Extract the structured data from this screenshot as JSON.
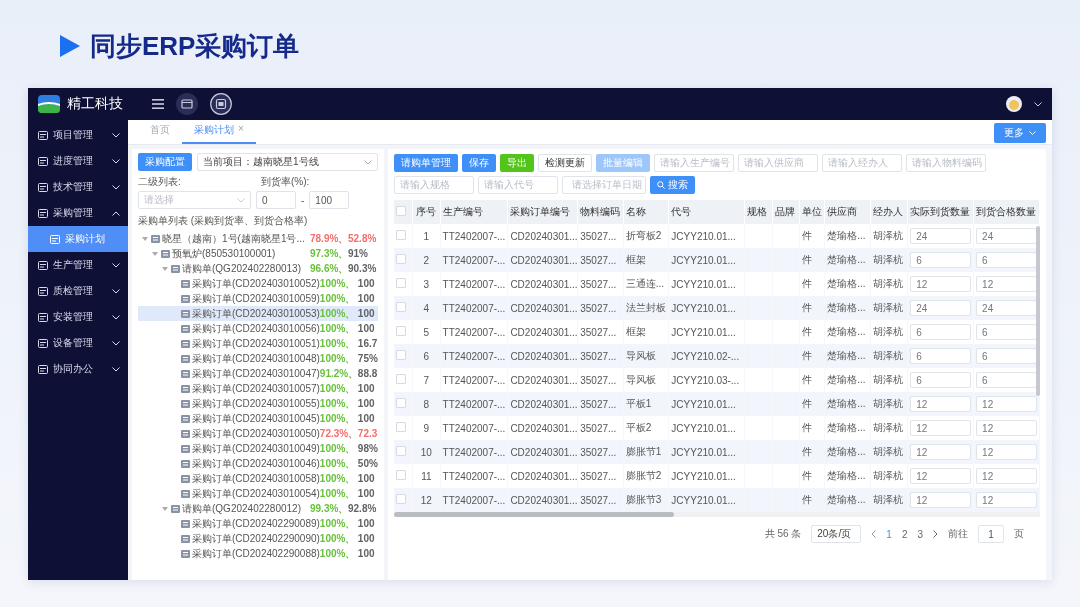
{
  "slide_title": "同步ERP采购订单",
  "header": {
    "brand": "精工科技"
  },
  "sidebar": {
    "items": [
      {
        "label": "项目管理",
        "selected": false,
        "expanded": false
      },
      {
        "label": "进度管理",
        "selected": false,
        "expanded": false
      },
      {
        "label": "技术管理",
        "selected": false,
        "expanded": false
      },
      {
        "label": "采购管理",
        "selected": false,
        "expanded": true,
        "children": [
          {
            "label": "采购计划",
            "selected": true
          }
        ]
      },
      {
        "label": "生产管理",
        "selected": false,
        "expanded": false
      },
      {
        "label": "质检管理",
        "selected": false,
        "expanded": false
      },
      {
        "label": "安装管理",
        "selected": false,
        "expanded": false
      },
      {
        "label": "设备管理",
        "selected": false,
        "expanded": false
      },
      {
        "label": "协同办公",
        "selected": false,
        "expanded": false
      }
    ]
  },
  "tabs": [
    {
      "label": "首页",
      "selected": false
    },
    {
      "label": "采购计划",
      "selected": true,
      "close": "×"
    }
  ],
  "more_button": "更多",
  "left_panel": {
    "config_button": "采购配置",
    "project": "当前项目：越南晓星1号线",
    "level2_label": "二级列表:",
    "level2_placeholder": "请选择",
    "rate_label": "到货率(%):",
    "rate_min": "0",
    "rate_sep": "-",
    "rate_max": "100",
    "list_title": "采购单列表 (采购到货率、到货合格率)",
    "tree": [
      {
        "label": "晓星（越南）1号(越南晓星1号...",
        "arrival": {
          "text": "78.9%、",
          "color": "#f56c6c"
        },
        "pass": {
          "text": "52.8%",
          "color": "#f56c6c"
        },
        "selected": false,
        "expanded": true,
        "children": [
          {
            "label": "预氧炉(850530100001)",
            "arrival": {
              "text": "97.3%、",
              "color": "#67c23a"
            },
            "pass": {
              "text": "91%",
              "color": "#606266"
            },
            "selected": false,
            "expanded": true,
            "children": [
              {
                "label": "请购单(QG202402280013)",
                "arrival": {
                  "text": "96.6%、",
                  "color": "#67c23a"
                },
                "pass": {
                  "text": "90.3%",
                  "color": "#606266"
                },
                "selected": false,
                "expanded": true,
                "children": [
                  {
                    "label": "采购订单(CD202403010052)",
                    "arrival": {
                      "text": "100%、",
                      "color": "#67c23a"
                    },
                    "pass": {
                      "text": "100",
                      "color": "#606266"
                    },
                    "selected": false
                  },
                  {
                    "label": "采购订单(CD202403010059)",
                    "arrival": {
                      "text": "100%、",
                      "color": "#67c23a"
                    },
                    "pass": {
                      "text": "100",
                      "color": "#606266"
                    },
                    "selected": false
                  },
                  {
                    "label": "采购订单(CD202403010053)",
                    "arrival": {
                      "text": "100%、",
                      "color": "#67c23a"
                    },
                    "pass": {
                      "text": "100",
                      "color": "#606266"
                    },
                    "selected": true
                  },
                  {
                    "label": "采购订单(CD202403010056)",
                    "arrival": {
                      "text": "100%、",
                      "color": "#67c23a"
                    },
                    "pass": {
                      "text": "100",
                      "color": "#606266"
                    },
                    "selected": false
                  },
                  {
                    "label": "采购订单(CD202403010051)",
                    "arrival": {
                      "text": "100%、",
                      "color": "#67c23a"
                    },
                    "pass": {
                      "text": "16.7",
                      "color": "#606266"
                    },
                    "selected": false
                  },
                  {
                    "label": "采购订单(CD202403010048)",
                    "arrival": {
                      "text": "100%、",
                      "color": "#67c23a"
                    },
                    "pass": {
                      "text": "75%",
                      "color": "#606266"
                    },
                    "selected": false
                  },
                  {
                    "label": "采购订单(CD202403010047)",
                    "arrival": {
                      "text": "91.2%、",
                      "color": "#67c23a"
                    },
                    "pass": {
                      "text": "88.8",
                      "color": "#606266"
                    },
                    "selected": false
                  },
                  {
                    "label": "采购订单(CD202403010057)",
                    "arrival": {
                      "text": "100%、",
                      "color": "#67c23a"
                    },
                    "pass": {
                      "text": "100",
                      "color": "#606266"
                    },
                    "selected": false
                  },
                  {
                    "label": "采购订单(CD202403010055)",
                    "arrival": {
                      "text": "100%、",
                      "color": "#67c23a"
                    },
                    "pass": {
                      "text": "100",
                      "color": "#606266"
                    },
                    "selected": false
                  },
                  {
                    "label": "采购订单(CD202403010045)",
                    "arrival": {
                      "text": "100%、",
                      "color": "#67c23a"
                    },
                    "pass": {
                      "text": "100",
                      "color": "#606266"
                    },
                    "selected": false
                  },
                  {
                    "label": "采购订单(CD202403010050)",
                    "arrival": {
                      "text": "72.3%、",
                      "color": "#f56c6c"
                    },
                    "pass": {
                      "text": "72.3",
                      "color": "#f56c6c"
                    },
                    "selected": false
                  },
                  {
                    "label": "采购订单(CD202403010049)",
                    "arrival": {
                      "text": "100%、",
                      "color": "#67c23a"
                    },
                    "pass": {
                      "text": "98%",
                      "color": "#606266"
                    },
                    "selected": false
                  },
                  {
                    "label": "采购订单(CD202403010046)",
                    "arrival": {
                      "text": "100%、",
                      "color": "#67c23a"
                    },
                    "pass": {
                      "text": "50%",
                      "color": "#606266"
                    },
                    "selected": false
                  },
                  {
                    "label": "采购订单(CD202403010058)",
                    "arrival": {
                      "text": "100%、",
                      "color": "#67c23a"
                    },
                    "pass": {
                      "text": "100",
                      "color": "#606266"
                    },
                    "selected": false
                  },
                  {
                    "label": "采购订单(CD202403010054)",
                    "arrival": {
                      "text": "100%、",
                      "color": "#67c23a"
                    },
                    "pass": {
                      "text": "100",
                      "color": "#606266"
                    },
                    "selected": false
                  }
                ]
              },
              {
                "label": "请购单(QG202402280012)",
                "arrival": {
                  "text": "99.3%、",
                  "color": "#67c23a"
                },
                "pass": {
                  "text": "92.8%",
                  "color": "#606266"
                },
                "selected": false,
                "expanded": true,
                "children": [
                  {
                    "label": "采购订单(CD202402290089)",
                    "arrival": {
                      "text": "100%、",
                      "color": "#67c23a"
                    },
                    "pass": {
                      "text": "100",
                      "color": "#606266"
                    },
                    "selected": false
                  },
                  {
                    "label": "采购订单(CD202402290090)",
                    "arrival": {
                      "text": "100%、",
                      "color": "#67c23a"
                    },
                    "pass": {
                      "text": "100",
                      "color": "#606266"
                    },
                    "selected": false
                  },
                  {
                    "label": "采购订单(CD202402290088)",
                    "arrival": {
                      "text": "100%、",
                      "color": "#67c23a"
                    },
                    "pass": {
                      "text": "100",
                      "color": "#606266"
                    },
                    "selected": false
                  }
                ]
              }
            ]
          }
        ]
      }
    ]
  },
  "toolbar": {
    "buttons": [
      {
        "label": "请购单管理",
        "kind": "primary",
        "disabled": false
      },
      {
        "label": "保存",
        "kind": "primary",
        "disabled": false
      },
      {
        "label": "导出",
        "kind": "success",
        "disabled": false
      },
      {
        "label": "检测更新",
        "kind": "plain",
        "disabled": false
      },
      {
        "label": "批量编辑",
        "kind": "primary",
        "disabled": true
      }
    ],
    "filters": [
      {
        "placeholder": "请输入生产编号",
        "kind": "text"
      },
      {
        "placeholder": "请输入供应商",
        "kind": "text"
      },
      {
        "placeholder": "请输入经办人",
        "kind": "text"
      },
      {
        "placeholder": "请输入物料编码",
        "kind": "text"
      },
      {
        "placeholder": "请输入规格",
        "kind": "text"
      },
      {
        "placeholder": "请输入代号",
        "kind": "text"
      },
      {
        "placeholder": "请选择订单日期",
        "kind": "date"
      }
    ],
    "search_button": "搜索"
  },
  "table": {
    "header_checked": false,
    "columns": [
      "序号",
      "生产编号",
      "采购订单编号",
      "物料编码",
      "名称",
      "代号",
      "规格",
      "品牌",
      "单位",
      "供应商",
      "经办人",
      "实际到货数量",
      "到货合格数量"
    ],
    "rows": [
      {
        "checked": false,
        "no": "1",
        "prod_no": "TT2402007-...",
        "order_no": "CD20240301...",
        "material": "35027...",
        "name": "折弯板2",
        "code": "JCYY210.01...",
        "unit": "件",
        "supplier": "楚瑜格...",
        "handler": "胡泽杭",
        "actual_qty": "24",
        "qualified_qty": "24"
      },
      {
        "checked": false,
        "no": "2",
        "prod_no": "TT2402007-...",
        "order_no": "CD20240301...",
        "material": "35027...",
        "name": "框架",
        "code": "JCYY210.01...",
        "unit": "件",
        "supplier": "楚瑜格...",
        "handler": "胡泽杭",
        "actual_qty": "6",
        "qualified_qty": "6"
      },
      {
        "checked": false,
        "no": "3",
        "prod_no": "TT2402007-...",
        "order_no": "CD20240301...",
        "material": "35027...",
        "name": "三通连...",
        "code": "JCYY210.01...",
        "unit": "件",
        "supplier": "楚瑜格...",
        "handler": "胡泽杭",
        "actual_qty": "12",
        "qualified_qty": "12"
      },
      {
        "checked": false,
        "no": "4",
        "prod_no": "TT2402007-...",
        "order_no": "CD20240301...",
        "material": "35027...",
        "name": "法兰封板",
        "code": "JCYY210.01...",
        "unit": "件",
        "supplier": "楚瑜格...",
        "handler": "胡泽杭",
        "actual_qty": "24",
        "qualified_qty": "24"
      },
      {
        "checked": false,
        "no": "5",
        "prod_no": "TT2402007-...",
        "order_no": "CD20240301...",
        "material": "35027...",
        "name": "框架",
        "code": "JCYY210.01...",
        "unit": "件",
        "supplier": "楚瑜格...",
        "handler": "胡泽杭",
        "actual_qty": "6",
        "qualified_qty": "6"
      },
      {
        "checked": false,
        "no": "6",
        "prod_no": "TT2402007-...",
        "order_no": "CD20240301...",
        "material": "35027...",
        "name": "导风板",
        "code": "JCYY210.02-...",
        "unit": "件",
        "supplier": "楚瑜格...",
        "handler": "胡泽杭",
        "actual_qty": "6",
        "qualified_qty": "6"
      },
      {
        "checked": false,
        "no": "7",
        "prod_no": "TT2402007-...",
        "order_no": "CD20240301...",
        "material": "35027...",
        "name": "导风板",
        "code": "JCYY210.03-...",
        "unit": "件",
        "supplier": "楚瑜格...",
        "handler": "胡泽杭",
        "actual_qty": "6",
        "qualified_qty": "6"
      },
      {
        "checked": false,
        "no": "8",
        "prod_no": "TT2402007-...",
        "order_no": "CD20240301...",
        "material": "35027...",
        "name": "平板1",
        "code": "JCYY210.01...",
        "unit": "件",
        "supplier": "楚瑜格...",
        "handler": "胡泽杭",
        "actual_qty": "12",
        "qualified_qty": "12"
      },
      {
        "checked": false,
        "no": "9",
        "prod_no": "TT2402007-...",
        "order_no": "CD20240301...",
        "material": "35027...",
        "name": "平板2",
        "code": "JCYY210.01...",
        "unit": "件",
        "supplier": "楚瑜格...",
        "handler": "胡泽杭",
        "actual_qty": "12",
        "qualified_qty": "12"
      },
      {
        "checked": false,
        "no": "10",
        "prod_no": "TT2402007-...",
        "order_no": "CD20240301...",
        "material": "35027...",
        "name": "膨胀节1",
        "code": "JCYY210.01...",
        "unit": "件",
        "supplier": "楚瑜格...",
        "handler": "胡泽杭",
        "actual_qty": "12",
        "qualified_qty": "12"
      },
      {
        "checked": false,
        "no": "11",
        "prod_no": "TT2402007-...",
        "order_no": "CD20240301...",
        "material": "35027...",
        "name": "膨胀节2",
        "code": "JCYY210.01...",
        "unit": "件",
        "supplier": "楚瑜格...",
        "handler": "胡泽杭",
        "actual_qty": "12",
        "qualified_qty": "12"
      },
      {
        "checked": false,
        "no": "12",
        "prod_no": "TT2402007-...",
        "order_no": "CD20240301...",
        "material": "35027...",
        "name": "膨胀节3",
        "code": "JCYY210.01...",
        "unit": "件",
        "supplier": "楚瑜格...",
        "handler": "胡泽杭",
        "actual_qty": "12",
        "qualified_qty": "12"
      }
    ]
  },
  "pagination": {
    "total": "共 56 条",
    "page_size": "20条/页",
    "pages": [
      {
        "label": "1",
        "selected": true
      },
      {
        "label": "2",
        "selected": false
      },
      {
        "label": "3",
        "selected": false
      }
    ],
    "goto_label": "前往",
    "goto_value": "1",
    "goto_suffix": "页"
  }
}
